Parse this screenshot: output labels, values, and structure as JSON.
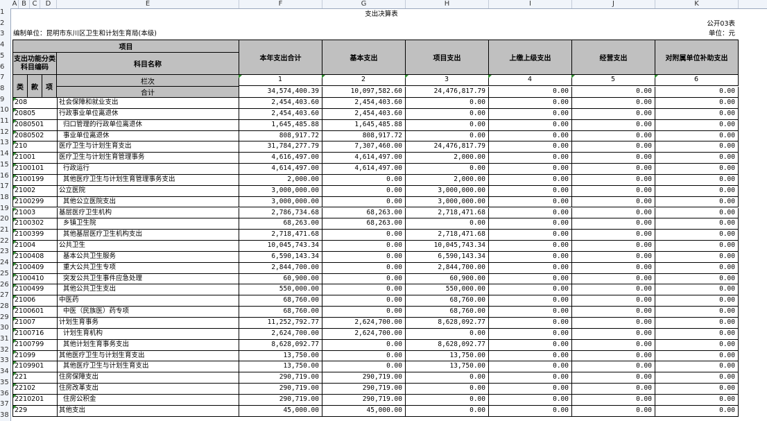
{
  "sheet": {
    "title": "支出决算表",
    "form_no": "公开03表",
    "unit": "单位：元",
    "org": "编制单位：昆明市东川区卫生和计划生育局(本级)",
    "col_letters": [
      "A",
      "B",
      "C",
      "D",
      "E",
      "F",
      "G",
      "H",
      "I",
      "J",
      "K"
    ],
    "row_numbers": [
      "1",
      "2",
      "3",
      "4",
      "5",
      "6",
      "7",
      "8",
      "9",
      "10",
      "11",
      "12",
      "13",
      "14",
      "15",
      "16",
      "17",
      "18",
      "19",
      "20",
      "21",
      "22",
      "23",
      "24",
      "25",
      "26",
      "27",
      "28",
      "29",
      "30",
      "31",
      "32",
      "33",
      "34",
      "35",
      "36",
      "37",
      "38"
    ],
    "headers": {
      "xiangmu": "项目",
      "func_code": "支出功能分类科目编码",
      "subject": "科目名称",
      "total": "本年支出合计",
      "basic": "基本支出",
      "project": "项目支出",
      "upper": "上缴上级支出",
      "business": "经营支出",
      "subsidy": "对附属单位补助支出",
      "lei": "类",
      "kuan": "款",
      "xiang": "项",
      "lanci": "栏次",
      "heji": "合计",
      "idx": [
        "1",
        "2",
        "3",
        "4",
        "5",
        "6"
      ]
    },
    "total_row": [
      "34,574,400.39",
      "10,097,582.60",
      "24,476,817.79",
      "0.00",
      "0.00",
      "0.00"
    ],
    "rows": [
      {
        "code": "208",
        "name": "社会保障和就业支出",
        "v": [
          "2,454,403.60",
          "2,454,403.60",
          "0.00",
          "0.00",
          "0.00",
          "0.00"
        ]
      },
      {
        "code": "20805",
        "name": "行政事业单位离退休",
        "v": [
          "2,454,403.60",
          "2,454,403.60",
          "0.00",
          "0.00",
          "0.00",
          "0.00"
        ]
      },
      {
        "code": "2080501",
        "name": "  归口管理的行政单位离退休",
        "v": [
          "1,645,485.88",
          "1,645,485.88",
          "0.00",
          "0.00",
          "0.00",
          "0.00"
        ]
      },
      {
        "code": "2080502",
        "name": "  事业单位离退休",
        "v": [
          "808,917.72",
          "808,917.72",
          "0.00",
          "0.00",
          "0.00",
          "0.00"
        ]
      },
      {
        "code": "210",
        "name": "医疗卫生与计划生育支出",
        "v": [
          "31,784,277.79",
          "7,307,460.00",
          "24,476,817.79",
          "0.00",
          "0.00",
          "0.00"
        ]
      },
      {
        "code": "21001",
        "name": "医疗卫生与计划生育管理事务",
        "v": [
          "4,616,497.00",
          "4,614,497.00",
          "2,000.00",
          "0.00",
          "0.00",
          "0.00"
        ]
      },
      {
        "code": "2100101",
        "name": "  行政运行",
        "v": [
          "4,614,497.00",
          "4,614,497.00",
          "0.00",
          "0.00",
          "0.00",
          "0.00"
        ]
      },
      {
        "code": "2100199",
        "name": "  其他医疗卫生与计划生育管理事务支出",
        "v": [
          "2,000.00",
          "0.00",
          "2,000.00",
          "0.00",
          "0.00",
          "0.00"
        ]
      },
      {
        "code": "21002",
        "name": "公立医院",
        "v": [
          "3,000,000.00",
          "0.00",
          "3,000,000.00",
          "0.00",
          "0.00",
          "0.00"
        ]
      },
      {
        "code": "2100299",
        "name": "  其他公立医院支出",
        "v": [
          "3,000,000.00",
          "0.00",
          "3,000,000.00",
          "0.00",
          "0.00",
          "0.00"
        ]
      },
      {
        "code": "21003",
        "name": "基层医疗卫生机构",
        "v": [
          "2,786,734.68",
          "68,263.00",
          "2,718,471.68",
          "0.00",
          "0.00",
          "0.00"
        ]
      },
      {
        "code": "2100302",
        "name": "  乡镇卫生院",
        "v": [
          "68,263.00",
          "68,263.00",
          "0.00",
          "0.00",
          "0.00",
          "0.00"
        ]
      },
      {
        "code": "2100399",
        "name": "  其他基层医疗卫生机构支出",
        "v": [
          "2,718,471.68",
          "0.00",
          "2,718,471.68",
          "0.00",
          "0.00",
          "0.00"
        ]
      },
      {
        "code": "21004",
        "name": "公共卫生",
        "v": [
          "10,045,743.34",
          "0.00",
          "10,045,743.34",
          "0.00",
          "0.00",
          "0.00"
        ]
      },
      {
        "code": "2100408",
        "name": "  基本公共卫生服务",
        "v": [
          "6,590,143.34",
          "0.00",
          "6,590,143.34",
          "0.00",
          "0.00",
          "0.00"
        ]
      },
      {
        "code": "2100409",
        "name": "  重大公共卫生专项",
        "v": [
          "2,844,700.00",
          "0.00",
          "2,844,700.00",
          "0.00",
          "0.00",
          "0.00"
        ]
      },
      {
        "code": "2100410",
        "name": "  突发公共卫生事件应急处理",
        "v": [
          "60,900.00",
          "0.00",
          "60,900.00",
          "0.00",
          "0.00",
          "0.00"
        ]
      },
      {
        "code": "2100499",
        "name": "  其他公共卫生支出",
        "v": [
          "550,000.00",
          "0.00",
          "550,000.00",
          "0.00",
          "0.00",
          "0.00"
        ]
      },
      {
        "code": "21006",
        "name": "中医药",
        "v": [
          "68,760.00",
          "0.00",
          "68,760.00",
          "0.00",
          "0.00",
          "0.00"
        ]
      },
      {
        "code": "2100601",
        "name": "  中医（民族医）药专项",
        "v": [
          "68,760.00",
          "0.00",
          "68,760.00",
          "0.00",
          "0.00",
          "0.00"
        ]
      },
      {
        "code": "21007",
        "name": "计划生育事务",
        "v": [
          "11,252,792.77",
          "2,624,700.00",
          "8,628,092.77",
          "0.00",
          "0.00",
          "0.00"
        ]
      },
      {
        "code": "2100716",
        "name": "  计划生育机构",
        "v": [
          "2,624,700.00",
          "2,624,700.00",
          "0.00",
          "0.00",
          "0.00",
          "0.00"
        ]
      },
      {
        "code": "2100799",
        "name": "  其他计划生育事务支出",
        "v": [
          "8,628,092.77",
          "0.00",
          "8,628,092.77",
          "0.00",
          "0.00",
          "0.00"
        ]
      },
      {
        "code": "21099",
        "name": "其他医疗卫生与计划生育支出",
        "v": [
          "13,750.00",
          "0.00",
          "13,750.00",
          "0.00",
          "0.00",
          "0.00"
        ]
      },
      {
        "code": "2109901",
        "name": "  其他医疗卫生与计划生育支出",
        "v": [
          "13,750.00",
          "0.00",
          "13,750.00",
          "0.00",
          "0.00",
          "0.00"
        ]
      },
      {
        "code": "221",
        "name": "住房保障支出",
        "v": [
          "290,719.00",
          "290,719.00",
          "0.00",
          "0.00",
          "0.00",
          "0.00"
        ]
      },
      {
        "code": "22102",
        "name": "住房改革支出",
        "v": [
          "290,719.00",
          "290,719.00",
          "0.00",
          "0.00",
          "0.00",
          "0.00"
        ]
      },
      {
        "code": "2210201",
        "name": "  住房公积金",
        "v": [
          "290,719.00",
          "290,719.00",
          "0.00",
          "0.00",
          "0.00",
          "0.00"
        ]
      },
      {
        "code": "229",
        "name": "其他支出",
        "v": [
          "45,000.00",
          "45,000.00",
          "0.00",
          "0.00",
          "0.00",
          "0.00"
        ]
      }
    ]
  }
}
